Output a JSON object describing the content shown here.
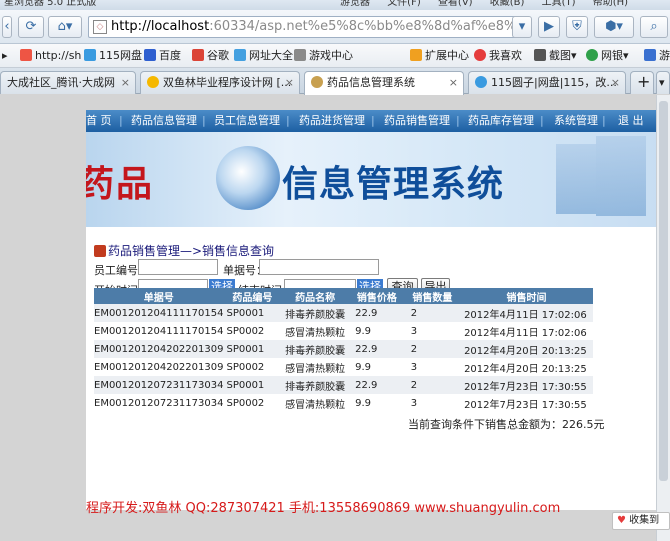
{
  "browser": {
    "title_text": "星浏览器 5.0 正式版",
    "title_right": [
      "游览器",
      "文件(F)",
      "查看(V)",
      "收藏(B)",
      "工具(T)",
      "帮助(H)"
    ],
    "address": {
      "host": "http://localhost",
      "rest": ":60334/asp.net%e5%8c%bb%e8%8d%af%e8%bf%9b%e9"
    },
    "bookmarks": [
      "http://sh",
      "115网盘",
      "百度",
      "谷歌",
      "网址大全",
      "游戏中心",
      "扩展中心",
      "我喜欢",
      "截图",
      "网银",
      "游"
    ],
    "tabs": [
      {
        "label": "大成社区_腾讯·大成网",
        "active": false
      },
      {
        "label": "双鱼林毕业程序设计网 [...",
        "active": false
      },
      {
        "label": "药品信息管理系统",
        "active": true
      },
      {
        "label": "115圆子|网盘|115，改...",
        "active": false
      }
    ],
    "new_tab": "+"
  },
  "app": {
    "menu": [
      "首 页",
      "药品信息管理",
      "员工信息管理",
      "药品进货管理",
      "药品销售管理",
      "药品库存管理",
      "系统管理",
      "退 出"
    ],
    "banner": {
      "left": "药品",
      "right": "信息管理系统"
    },
    "breadcrumb": "药品销售管理—>销售信息查询",
    "form": {
      "employee_label": "员工编号：",
      "employee_value": "",
      "bill_label": "单据号：",
      "bill_value": "",
      "start_label": "开始时间：",
      "start_value": "",
      "end_label": "结束时间：",
      "end_value": "",
      "pick_label": "选择",
      "query_label": "查询",
      "export_label": "导出"
    },
    "table": {
      "headers": [
        "单据号",
        "药品编号",
        "药品名称",
        "销售价格",
        "销售数量",
        "销售时间"
      ],
      "rows": [
        [
          "EM001201204111170154",
          "SP0001",
          "排毒养颜胶囊",
          "22.9",
          "2",
          "2012年4月11日  17:02:06"
        ],
        [
          "EM001201204111170154",
          "SP0002",
          "感冒清热颗粒",
          "9.9",
          "3",
          "2012年4月11日  17:02:06"
        ],
        [
          "EM001201204202201309",
          "SP0001",
          "排毒养颜胶囊",
          "22.9",
          "2",
          "2012年4月20日  20:13:25"
        ],
        [
          "EM001201204202201309",
          "SP0002",
          "感冒清热颗粒",
          "9.9",
          "3",
          "2012年4月20日  20:13:25"
        ],
        [
          "EM001201207231173034",
          "SP0001",
          "排毒养颜胶囊",
          "22.9",
          "2",
          "2012年7月23日  17:30:55"
        ],
        [
          "EM001201207231173034",
          "SP0002",
          "感冒清热颗粒",
          "9.9",
          "3",
          "2012年7月23日  17:30:55"
        ]
      ]
    },
    "summary": "当前查询条件下销售总金额为：226.5元"
  },
  "footer": "程序开发:双鱼林 QQ:287307421 手机:13558690869 www.shuangyulin.com",
  "fav_button": "收集到"
}
